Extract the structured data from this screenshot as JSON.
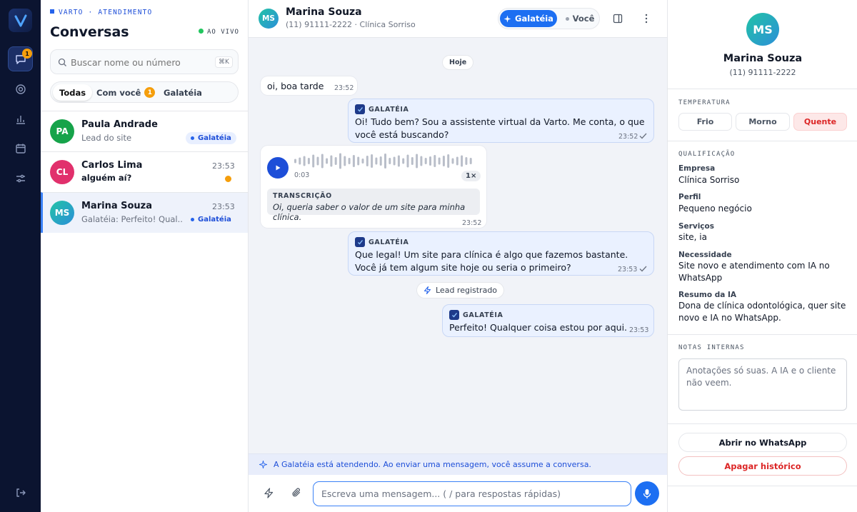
{
  "rail": {
    "chat_badge": "1"
  },
  "list": {
    "eyebrow": "VARTO · ATENDIMENTO",
    "title": "Conversas",
    "live": "AO VIVO",
    "search_placeholder": "Buscar nome ou número",
    "search_shortcut": "⌘K",
    "tabs": [
      {
        "label": "Todas"
      },
      {
        "label": "Com você",
        "badge": "1"
      },
      {
        "label": "Galatéia"
      }
    ],
    "conversations": [
      {
        "initials": "PA",
        "name": "Paula Andrade",
        "preview": "Lead do site",
        "time": "",
        "tag": "Galatéia",
        "color": "#16a34a"
      },
      {
        "initials": "CL",
        "name": "Carlos Lima",
        "preview": "alguém aí?",
        "time": "23:53",
        "tag": "",
        "color": "#e1306c"
      },
      {
        "initials": "MS",
        "name": "Marina Souza",
        "preview": "Galatéia: Perfeito! Qual...",
        "time": "23:53",
        "tag": "Galatéia",
        "color": "#14b8a6"
      }
    ]
  },
  "chat": {
    "initials": "MS",
    "name": "Marina Souza",
    "subtitle": "(11) 91111-2222 · Clínica Sorriso",
    "mode_ai": "Galatéia",
    "mode_you": "Você",
    "day": "Hoje",
    "messages": [
      {
        "text": "oi, boa tarde",
        "time": "23:52"
      },
      {
        "sender": "GALATÉIA",
        "text": "Oi! Tudo bem? Sou a assistente virtual da Varto. Me conta, o que você está buscando?",
        "time": "23:52"
      },
      {
        "duration": "0:03",
        "speed": "1×",
        "transcript_label": "TRANSCRIÇÃO",
        "transcript": "Oi, queria saber o valor de um site para minha clínica.",
        "time": "23:52"
      },
      {
        "sender": "GALATÉIA",
        "text": "Que legal! Um site para clínica é algo que fazemos bastante. Você já tem algum site hoje ou seria o primeiro?",
        "time": "23:53"
      },
      {
        "sender": "GALATÉIA",
        "text": "Perfeito! Qualquer coisa estou por aqui.",
        "time": "23:53"
      }
    ],
    "event": "Lead registrado",
    "banner": "A Galatéia está atendendo. Ao enviar uma mensagem, você assume a conversa.",
    "composer_placeholder": "Escreva uma mensagem...  ( / para respostas rápidas)"
  },
  "profile": {
    "initials": "MS",
    "name": "Marina Souza",
    "phone": "(11) 91111-2222",
    "temp_title": "TEMPERATURA",
    "temps": [
      "Frio",
      "Morno",
      "Quente"
    ],
    "qual_title": "QUALIFICAÇÃO",
    "fields": [
      {
        "label": "Empresa",
        "value": "Clínica Sorriso"
      },
      {
        "label": "Perfil",
        "value": "Pequeno negócio"
      },
      {
        "label": "Serviços",
        "value": "site, ia"
      },
      {
        "label": "Necessidade",
        "value": "Site novo e atendimento com IA no WhatsApp"
      },
      {
        "label": "Resumo da IA",
        "value": "Dona de clínica odontológica, quer site novo e IA no WhatsApp."
      }
    ],
    "notes_title": "NOTAS INTERNAS",
    "notes_placeholder": "Anotações só suas. A IA e o cliente não veem.",
    "open_whatsapp": "Abrir no WhatsApp",
    "clear_history": "Apagar histórico"
  },
  "colors": {
    "accent": "#1d6ff2",
    "rail": "#0b1430",
    "hot": "#dc2626",
    "badge": "#f59e0b"
  }
}
